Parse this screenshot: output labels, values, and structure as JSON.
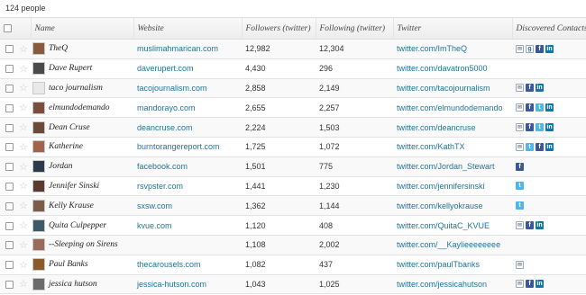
{
  "count_label": "124 people",
  "columns": {
    "name": "Name",
    "website": "Website",
    "followers": "Followers (twitter)",
    "following": "Following (twitter)",
    "twitter": "Twitter",
    "contacts": "Discovered Contacts"
  },
  "rows": [
    {
      "name": "TheQ",
      "website": "muslimahmarican.com",
      "followers": "12,982",
      "following": "12,304",
      "twitter": "twitter.com/ImTheQ",
      "icons": [
        "email-icon",
        "google-talk-icon",
        "facebook-icon",
        "linkedin-icon"
      ]
    },
    {
      "name": "Dave Rupert",
      "website": "daverupert.com",
      "followers": "4,430",
      "following": "296",
      "twitter": "twitter.com/davatron5000",
      "icons": []
    },
    {
      "name": "taco journalism",
      "website": "tacojournalism.com",
      "followers": "2,858",
      "following": "2,149",
      "twitter": "twitter.com/tacojournalism",
      "icons": [
        "email-icon",
        "facebook-icon",
        "linkedin-icon"
      ]
    },
    {
      "name": "elmundodemando",
      "website": "mandorayo.com",
      "followers": "2,655",
      "following": "2,257",
      "twitter": "twitter.com/elmundodemando",
      "icons": [
        "email-icon",
        "facebook-icon",
        "twitter-icon",
        "linkedin-icon"
      ]
    },
    {
      "name": "Dean Cruse",
      "website": "deancruse.com",
      "followers": "2,224",
      "following": "1,503",
      "twitter": "twitter.com/deancruse",
      "icons": [
        "email-icon",
        "facebook-icon",
        "twitter-icon",
        "linkedin-icon"
      ]
    },
    {
      "name": "Katherine",
      "website": "burntorangereport.com",
      "followers": "1,725",
      "following": "1,072",
      "twitter": "twitter.com/KathTX",
      "icons": [
        "email-icon",
        "twitter-icon",
        "facebook-icon",
        "linkedin-icon"
      ]
    },
    {
      "name": "Jordan",
      "website": "facebook.com",
      "followers": "1,501",
      "following": "775",
      "twitter": "twitter.com/Jordan_Stewart",
      "icons": [
        "facebook-icon"
      ]
    },
    {
      "name": "Jennifer Sinski",
      "website": "rsvpster.com",
      "followers": "1,441",
      "following": "1,230",
      "twitter": "twitter.com/jennifersinski",
      "icons": [
        "twitter-icon"
      ]
    },
    {
      "name": "Kelly Krause",
      "website": "sxsw.com",
      "followers": "1,362",
      "following": "1,144",
      "twitter": "twitter.com/kellyokrause",
      "icons": [
        "twitter-icon"
      ]
    },
    {
      "name": "Quita Culpepper",
      "website": "kvue.com",
      "followers": "1,120",
      "following": "408",
      "twitter": "twitter.com/QuitaC_KVUE",
      "icons": [
        "email-icon",
        "facebook-icon",
        "linkedin-icon"
      ]
    },
    {
      "name": "--Sleeping on Sirens",
      "website": "",
      "followers": "1,108",
      "following": "2,002",
      "twitter": "twitter.com/__Kaylieeeeeeee",
      "icons": []
    },
    {
      "name": "Paul Banks",
      "website": "thecarousels.com",
      "followers": "1,082",
      "following": "437",
      "twitter": "twitter.com/paulTbanks",
      "icons": [
        "email-icon"
      ]
    },
    {
      "name": "jessica hutson",
      "website": "jessica-hutson.com",
      "followers": "1,043",
      "following": "1,025",
      "twitter": "twitter.com/jessicahutson",
      "icons": [
        "email-icon",
        "facebook-icon",
        "linkedin-icon"
      ]
    }
  ],
  "avatar_colors": [
    "#8a5a3c",
    "#4a4a4a",
    "#e9e9e9",
    "#7a4e3a",
    "#6b4a3a",
    "#a0644a",
    "#2d3a4c",
    "#5c3a30",
    "#7b5e4a",
    "#3d5a6a",
    "#9a6a5a",
    "#8b5a2b",
    "#6a6a6a"
  ]
}
